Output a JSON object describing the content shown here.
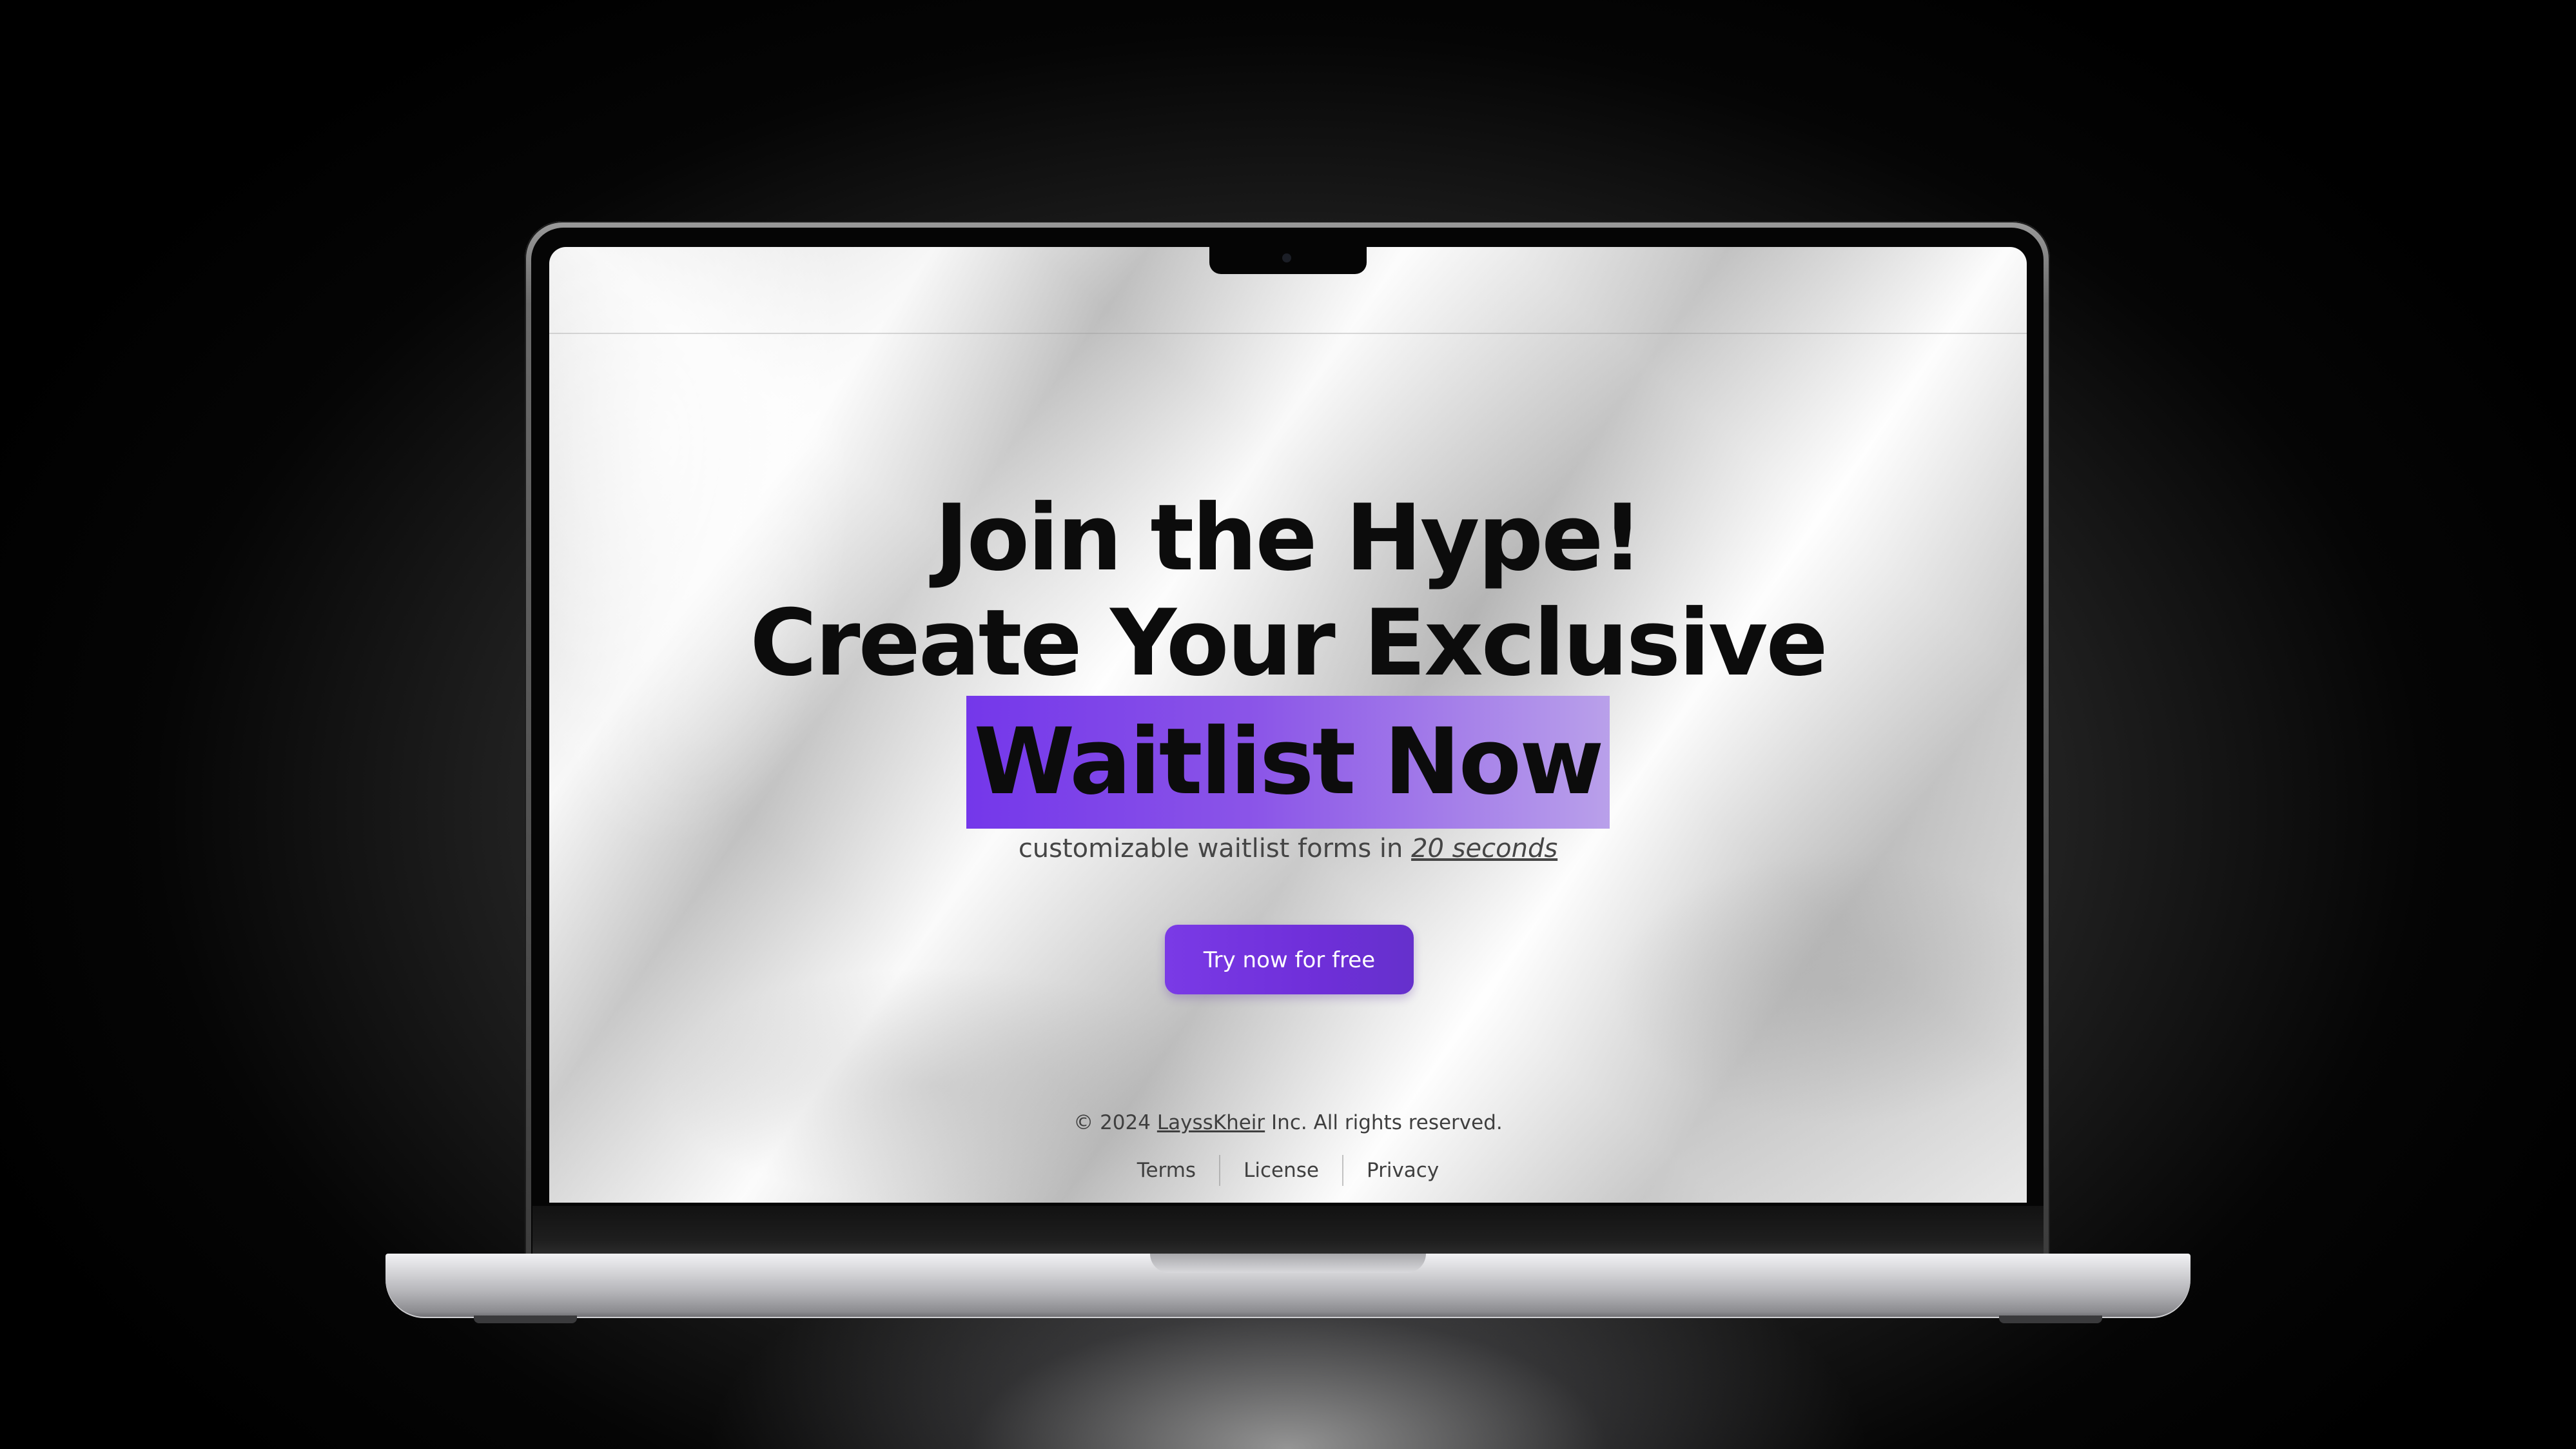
{
  "headline": {
    "line1": "Join the Hype!",
    "line2": "Create Your Exclusive",
    "highlight": "Waitlist Now"
  },
  "subtitle": {
    "text": "customizable waitlist forms in ",
    "emphasis": "20 seconds"
  },
  "cta": {
    "label": "Try now for free"
  },
  "footer": {
    "copyright_prefix": "© 2024 ",
    "brand": "LayssKheir",
    "copyright_suffix": " Inc. All rights reserved.",
    "links": [
      "Terms",
      "License",
      "Privacy"
    ]
  },
  "colors": {
    "accent": "#7437ea",
    "accent_light": "#b9a0ea",
    "text": "#0c0c0c"
  }
}
